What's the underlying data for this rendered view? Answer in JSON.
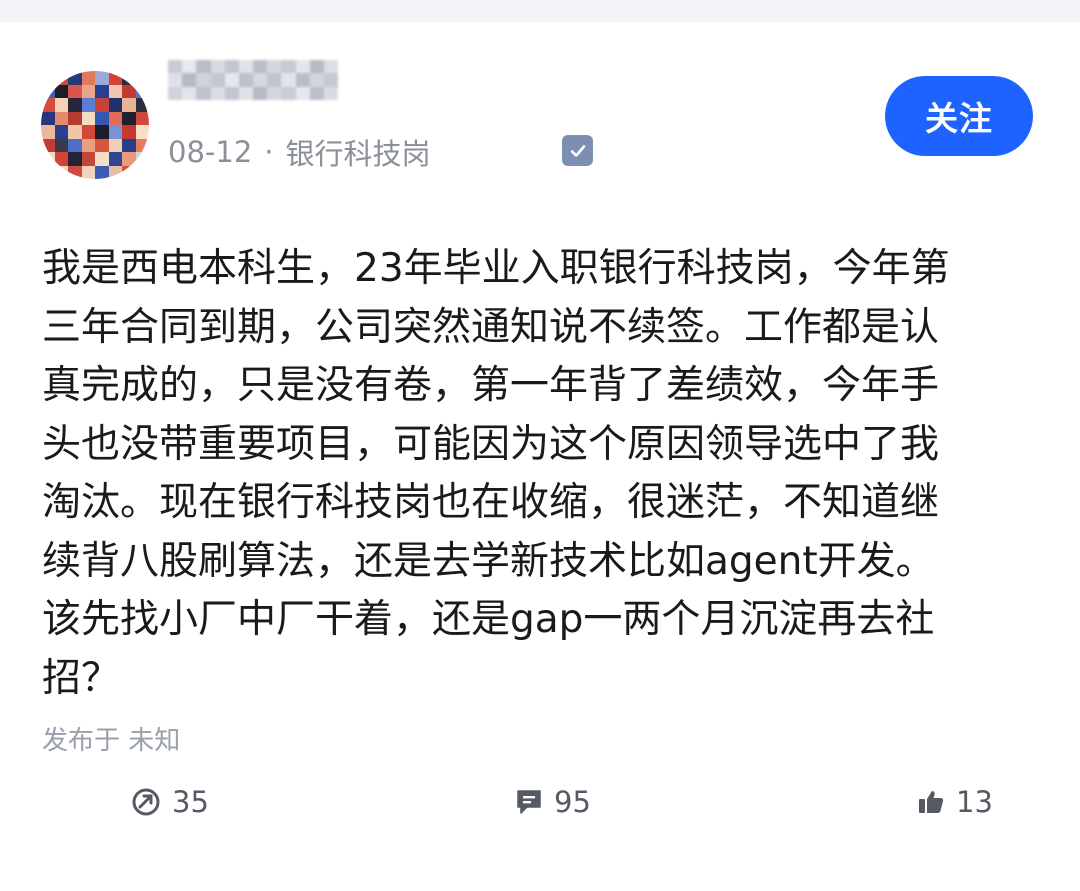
{
  "post": {
    "date": "08-12",
    "separator": "·",
    "category": "银行科技岗",
    "follow_label": "关注",
    "body_lines": [
      "我是西电本科生，23年毕业入职银行科技岗，今年第",
      "三年合同到期，公司突然通知说不续签。工作都是认",
      "真完成的，只是没有卷，第一年背了差绩效，今年手",
      "头也没带重要项目，可能因为这个原因领导选中了我",
      "淘汰。现在银行科技岗也在收缩，很迷茫，不知道继",
      "续背八股刷算法，还是去学新技术比如agent开发。",
      "该先找小厂中厂干着，还是gap一两个月沉淀再去社",
      "招？"
    ],
    "published_label": "发布于 未知"
  },
  "stats": {
    "share_count": "35",
    "comment_count": "95",
    "like_count": "13"
  },
  "icons": {
    "share": "share-arrow-icon",
    "comment": "comment-bubble-icon",
    "like": "thumbs-up-icon",
    "verified": "verified-check-icon"
  },
  "colors": {
    "accent": "#1e63ff",
    "meta_text": "#8a8f99",
    "body_text": "#1a1a1a",
    "verified_badge": "#7c8fb3"
  }
}
